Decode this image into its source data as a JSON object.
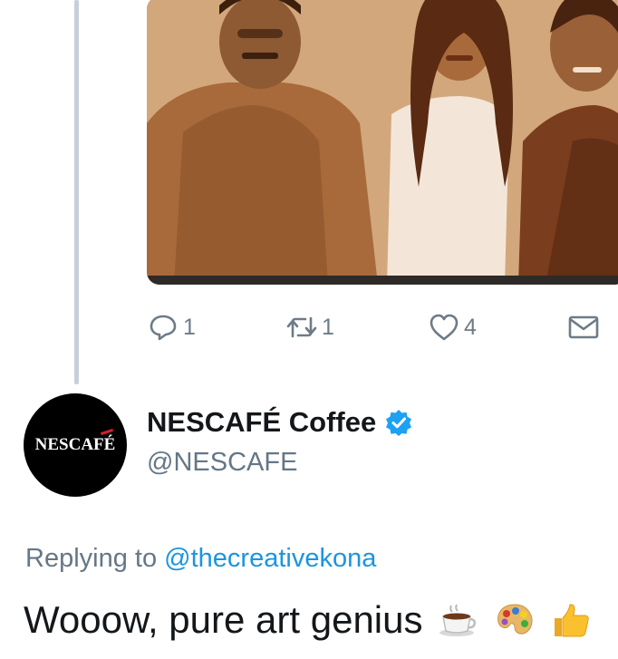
{
  "tweet_actions": {
    "reply_count": "1",
    "retweet_count": "1",
    "like_count": "4"
  },
  "reply_tweet": {
    "avatar_logo_text": "NESCAFÉ",
    "display_name": "NESCAFÉ Coffee",
    "handle": "@NESCAFE",
    "replying_prefix": "Replying to",
    "replying_to": "@thecreativekona",
    "text": "Wooow, pure art genius",
    "emojis": [
      "coffee-cup-emoji",
      "artist-palette-emoji",
      "thumbs-up-emoji"
    ]
  },
  "colors": {
    "action_gray": "#6e7b86",
    "link_blue": "#1b95e0",
    "verified_blue": "#1da1f2",
    "thread_line": "#c7d0d9"
  }
}
